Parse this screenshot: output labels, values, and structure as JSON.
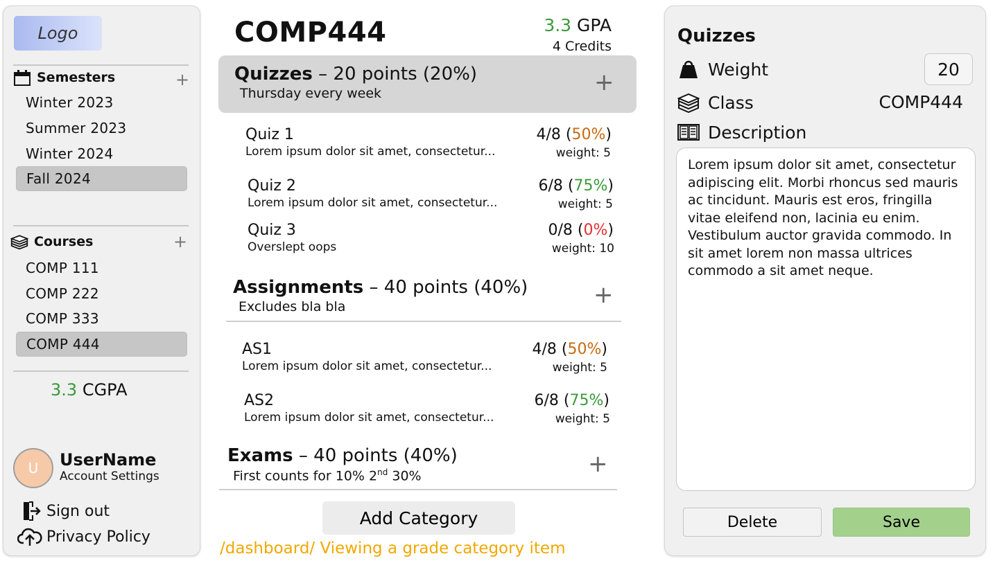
{
  "sidebar": {
    "logo": "Logo",
    "semesters": {
      "title": "Semesters",
      "items": [
        "Winter 2023",
        "Summer 2023",
        "Winter 2024",
        "Fall 2024"
      ],
      "active": "Fall 2024"
    },
    "courses": {
      "title": "Courses",
      "items": [
        "COMP 111",
        "COMP 222",
        "COMP 333",
        "COMP 444"
      ],
      "active": "COMP 444"
    },
    "cgpa": {
      "value": "3.3",
      "label": "CGPA"
    },
    "user": {
      "avatar_initial": "U",
      "name": "UserName",
      "settings": "Account Settings"
    },
    "links": {
      "sign_out": "Sign out",
      "privacy": "Privacy Policy"
    }
  },
  "main": {
    "course": "COMP444",
    "gpa": {
      "value": "3.3",
      "label": "GPA"
    },
    "credits": "4 Credits",
    "categories": [
      {
        "name": "Quizzes",
        "points": "– 20 points (20%)",
        "subtitle": "Thursday every week",
        "items": [
          {
            "title": "Quiz 1",
            "desc": "Lorem ipsum dolor sit amet, consectetur...",
            "score": "4/8",
            "pct": "50%",
            "weight": "weight: 5"
          },
          {
            "title": "Quiz 2",
            "desc": "Lorem ipsum dolor sit amet, consectetur...",
            "score": "6/8",
            "pct": "75%",
            "weight": "weight: 5"
          },
          {
            "title": "Quiz 3",
            "desc": "Overslept oops",
            "score": "0/8",
            "pct": "0%",
            "weight": "weight: 10"
          }
        ]
      },
      {
        "name": "Assignments",
        "points": "– 40 points (40%)",
        "subtitle": "Excludes bla bla",
        "items": [
          {
            "title": "AS1",
            "desc": "Lorem ipsum dolor sit amet, consectetur...",
            "score": "4/8",
            "pct": "50%",
            "weight": "weight: 5"
          },
          {
            "title": "AS2",
            "desc": "Lorem ipsum dolor sit amet, consectetur...",
            "score": "6/8",
            "pct": "75%",
            "weight": "weight: 5"
          }
        ]
      },
      {
        "name": "Exams",
        "points": "– 40 points (40%)",
        "subtitle_pre": "First counts for 10% 2",
        "subtitle_sup": "nd",
        "subtitle_post": " 30%"
      }
    ],
    "add_category": "Add Category",
    "route_note": "/dashboard/ Viewing a grade category item"
  },
  "panel": {
    "title": "Quizzes",
    "weight_label": "Weight",
    "weight_value": "20",
    "class_label": "Class",
    "class_value": "COMP444",
    "description_label": "Description",
    "description": "Lorem ipsum dolor sit amet, consectetur adipiscing elit. Morbi rhoncus sed mauris ac tincidunt. Mauris est eros, fringilla vitae eleifend non, lacinia eu enim. Vestibulum auctor gravida commodo. In sit amet lorem non massa ultrices commodo a sit amet neque.",
    "delete": "Delete",
    "save": "Save"
  },
  "colors": {
    "good": "#3a9a3a",
    "medium": "#c86a10",
    "bad": "#e23030",
    "save": "#a3d18c",
    "logo_gradient": [
      "#a9b9ef",
      "#dbe3fb"
    ],
    "route_note": "#f0a800"
  },
  "icons": {
    "semesters": "calendar-icon",
    "courses": "books-stack-icon",
    "sign_out": "sign-out-icon",
    "privacy": "cloud-upload-icon",
    "weight": "weight-icon",
    "class": "books-stack-icon",
    "description": "open-book-icon"
  }
}
